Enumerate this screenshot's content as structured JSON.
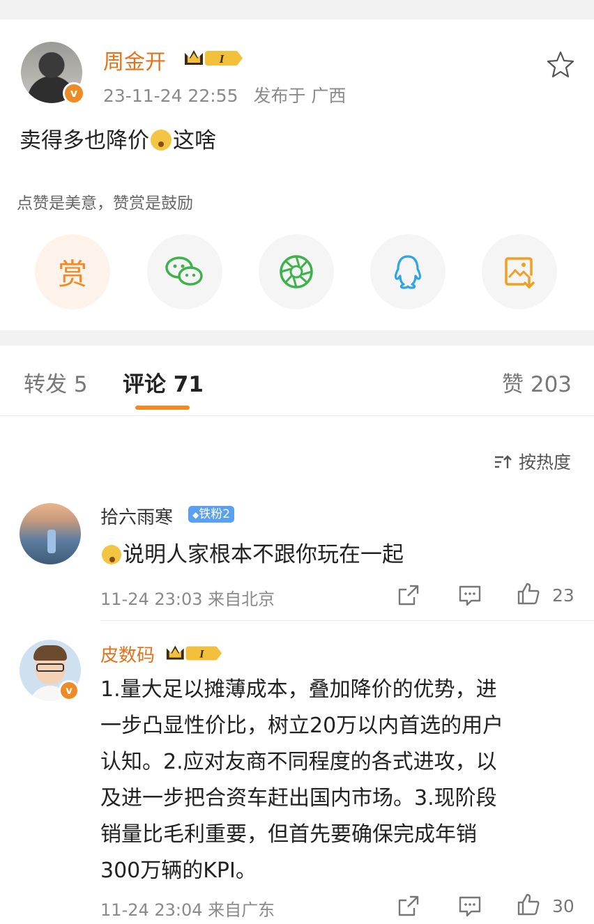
{
  "post": {
    "author": "周金开",
    "level": "I",
    "timestamp": "23-11-24 22:55",
    "location": "发布于 广西",
    "text_before": "卖得多也降价",
    "text_after": "这啥",
    "reward_tip": "点赞是美意，赞赏是鼓励",
    "share_buttons": [
      {
        "name": "reward",
        "label": "赏"
      },
      {
        "name": "wechat",
        "label": ""
      },
      {
        "name": "moments",
        "label": ""
      },
      {
        "name": "qq",
        "label": ""
      },
      {
        "name": "save-image",
        "label": ""
      }
    ]
  },
  "tabs": {
    "repost": "转发 5",
    "comments": "评论 71",
    "likes": "赞 203"
  },
  "sort_label": "按热度",
  "comments": [
    {
      "user": "拾六雨寒",
      "badge": "铁粉2",
      "text": "说明人家根本不跟你玩在一起",
      "time_location": "11-24 23:03 来自北京",
      "like_count": "23"
    },
    {
      "user": "皮数码",
      "level": "I",
      "text_lines": [
        "1.量大足以摊薄成本，叠加降价的优势，进",
        "一步凸显性价比，树立20万以内首选的用户",
        "认知。2.应对友商不同程度的各式进攻，以",
        "及进一步把合资车赶出国内市场。3.现阶段",
        "销量比毛利重要，但首先要确保完成年销",
        "300万辆的KPI。"
      ],
      "time_location": "11-24 23:04 来自广东",
      "like_count": "30"
    }
  ],
  "colors": {
    "accent": "#f08a24",
    "username": "#e2731b",
    "fan_badge": "#5aa0f0",
    "meta_gray": "#8a8a8a"
  }
}
